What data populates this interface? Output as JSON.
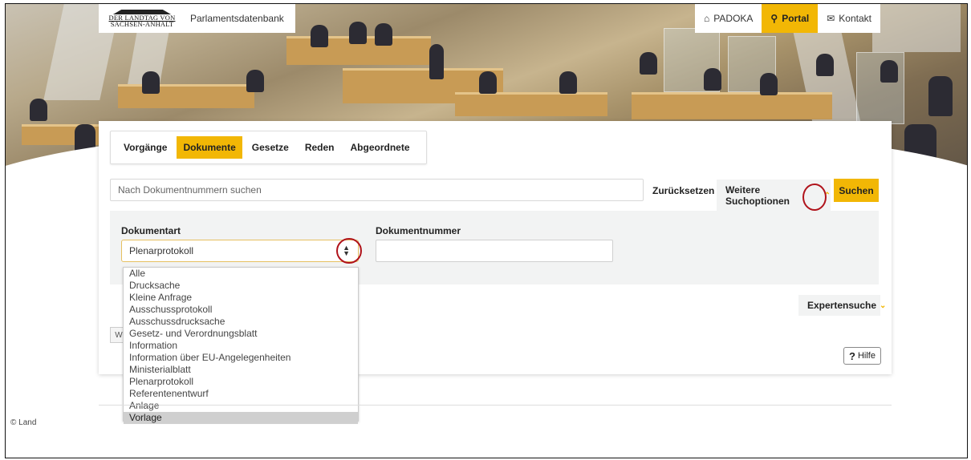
{
  "header": {
    "logo_line1": "DER LANDTAG VON",
    "logo_line2": "SACHSEN-ANHALT",
    "site_name": "Parlamentsdatenbank"
  },
  "topnav": {
    "items": [
      {
        "label": "PADOKA",
        "icon": "home-icon",
        "active": false
      },
      {
        "label": "Portal",
        "icon": "search-icon",
        "active": true
      },
      {
        "label": "Kontakt",
        "icon": "envelope-icon",
        "active": false
      }
    ]
  },
  "tabs": [
    {
      "label": "Vorgänge",
      "active": false
    },
    {
      "label": "Dokumente",
      "active": true
    },
    {
      "label": "Gesetze",
      "active": false
    },
    {
      "label": "Reden",
      "active": false
    },
    {
      "label": "Abgeordnete",
      "active": false
    }
  ],
  "search": {
    "placeholder": "Nach Dokumentnummern suchen",
    "reset_label": "Zurücksetzen",
    "more_options_label": "Weitere Suchoptionen",
    "submit_label": "Suchen"
  },
  "options": {
    "doctype_label": "Dokumentart",
    "doctype_value": "Plenarprotokoll",
    "docnum_label": "Dokumentnummer",
    "docnum_value": ""
  },
  "dropdown": {
    "items": [
      "Alle",
      "Drucksache",
      "Kleine Anfrage",
      "Ausschussprotokoll",
      "Ausschussdrucksache",
      "Gesetz- und Verordnungsblatt",
      "Information",
      "Information über EU-Angelegenheiten",
      "Ministerialblatt",
      "Plenarprotokoll",
      "Referentenentwurf",
      "Anlage",
      "Vorlage"
    ],
    "highlighted": "Vorlage"
  },
  "expert_label": "Expertensuche",
  "stub_label": "W",
  "help_label": "Hilfe",
  "footer_text": "© Land",
  "colors": {
    "accent": "#f2b705",
    "annotation": "#b0131b"
  }
}
